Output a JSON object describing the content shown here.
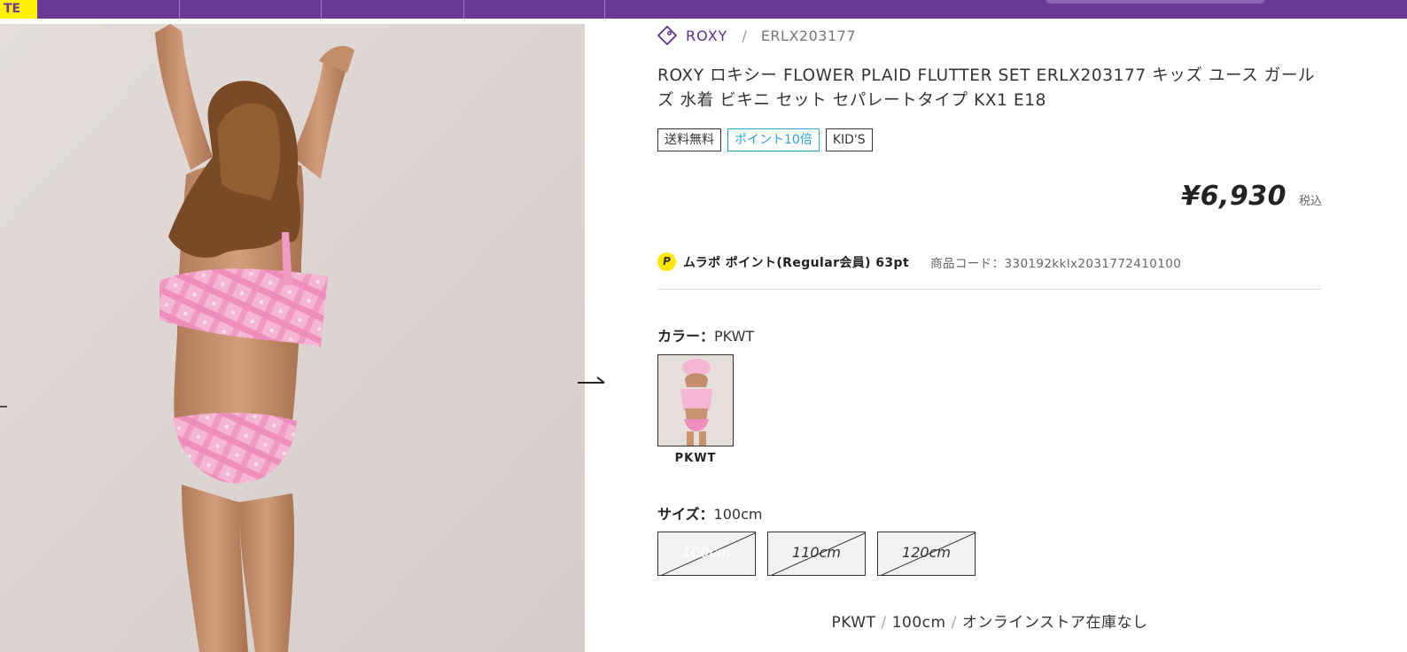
{
  "header": {
    "logo_text": "TE",
    "brand_color": "#6b3a99",
    "logo_bg": "#fff200"
  },
  "gallery": {
    "image_icon": "product-photo",
    "prev_icon": "arrow-left-icon",
    "next_icon": "arrow-right-icon"
  },
  "breadcrumb": {
    "icon": "tag-icon",
    "brand": "ROXY",
    "separator": "/",
    "code": "ERLX203177"
  },
  "product": {
    "title_line1": "ROXY ロキシー FLOWER PLAID FLUTTER SET ERLX203177 キッズ ユース ガール",
    "title_line2": "ズ 水着 ビキニ セット セパレートタイプ KX1 E18",
    "badges": [
      "送料無料",
      "ポイント10倍",
      "KID'S"
    ],
    "price": "¥6,930",
    "tax_label": "税込",
    "points_icon": "P",
    "points_text": "ムラポ ポイント(Regular会員) 63pt",
    "product_code": "商品コード：330192kklx2031772410100"
  },
  "color": {
    "label": "カラー：",
    "value": "PKWT",
    "swatches": [
      {
        "name": "PKWT"
      }
    ]
  },
  "size": {
    "label": "サイズ：",
    "value": "100cm",
    "options": [
      "100cm",
      "110cm",
      "120cm"
    ],
    "selected_index": 0
  },
  "stock": {
    "color": "PKWT",
    "size": "100cm",
    "separator": "/",
    "status": "オンラインストア在庫なし"
  }
}
